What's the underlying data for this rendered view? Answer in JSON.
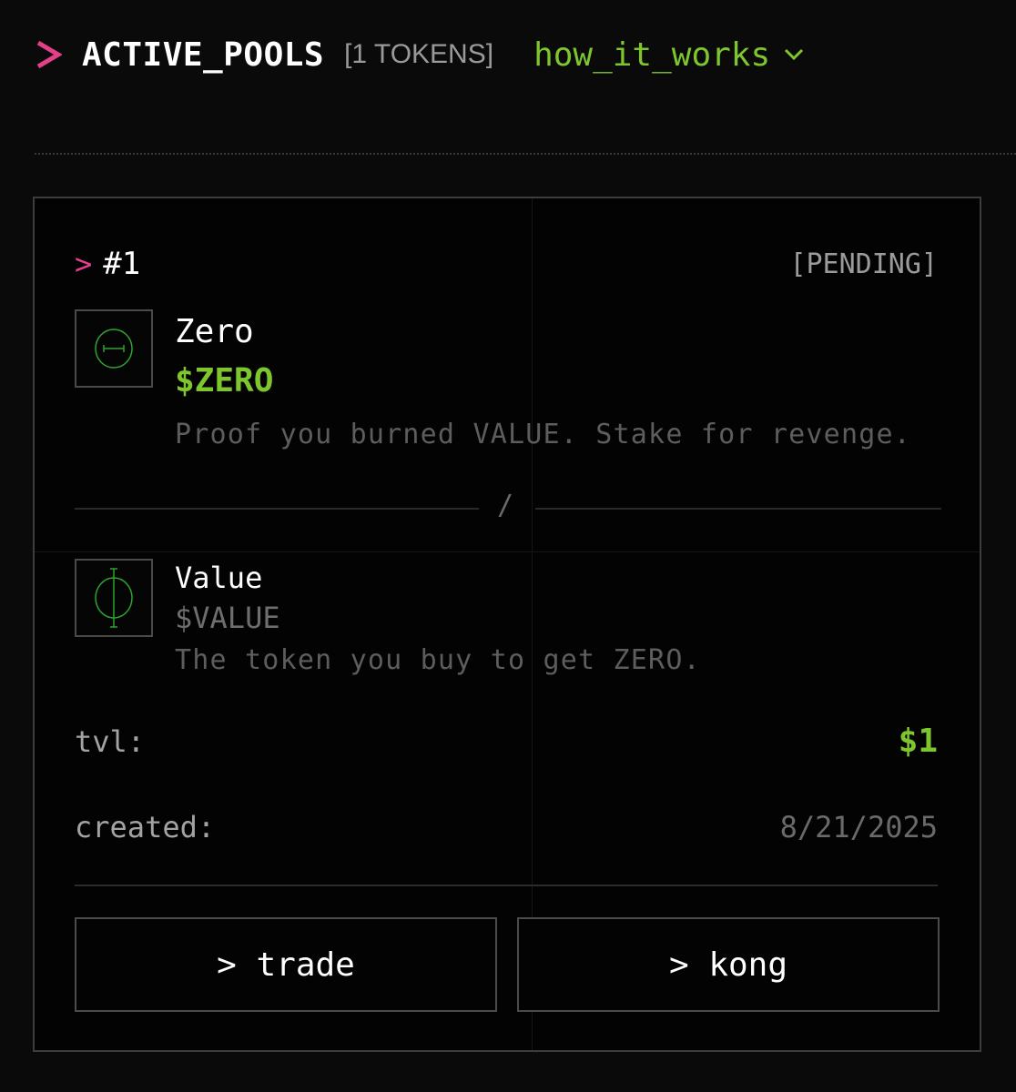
{
  "header": {
    "title": "ACTIVE_POOLS",
    "token_count": "[1 TOKENS]",
    "how_link": "how_it_works",
    "accent_pink": "#e4408a",
    "accent_green": "#7ec62e"
  },
  "pool": {
    "rank": "#1",
    "status": "[PENDING]",
    "token_a": {
      "name": "Zero",
      "symbol": "$ZERO",
      "description": "Proof you burned VALUE. Stake for revenge.",
      "icon": "zero-token-icon"
    },
    "separator": "/",
    "token_b": {
      "name": "Value",
      "symbol": "$VALUE",
      "description": "The token you buy to get ZERO.",
      "icon": "value-token-icon"
    },
    "tvl_label": "tvl:",
    "tvl_value": "$1",
    "created_label": "created:",
    "created_value": "8/21/2025",
    "buttons": {
      "trade": "> trade",
      "kong": "> kong"
    }
  }
}
